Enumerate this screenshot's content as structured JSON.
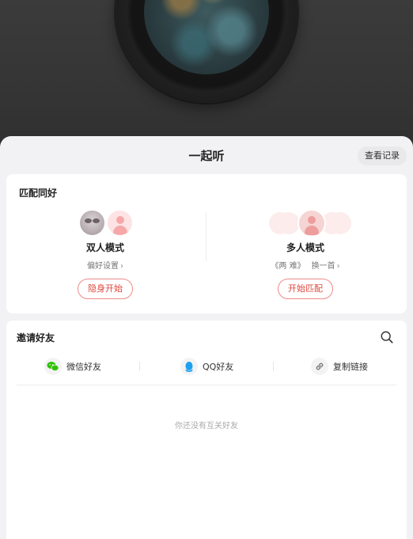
{
  "sheet": {
    "title": "一起听",
    "history_label": "查看记录"
  },
  "match": {
    "title": "匹配同好",
    "duo": {
      "name": "双人模式",
      "sub_label": "偏好设置",
      "button_label": "隐身开始"
    },
    "multi": {
      "name": "多人模式",
      "song_label": "《两 难》",
      "switch_label": "换一首",
      "button_label": "开始匹配"
    }
  },
  "invite": {
    "title": "邀请好友",
    "share_options": [
      {
        "label": "微信好友",
        "icon": "wechat-icon"
      },
      {
        "label": "QQ好友",
        "icon": "qq-icon"
      },
      {
        "label": "复制链接",
        "icon": "link-icon"
      }
    ],
    "empty_text": "你还没有互关好友"
  },
  "colors": {
    "accent": "#e0473f",
    "wechat": "#2dc100",
    "qq": "#1ea0f0"
  }
}
